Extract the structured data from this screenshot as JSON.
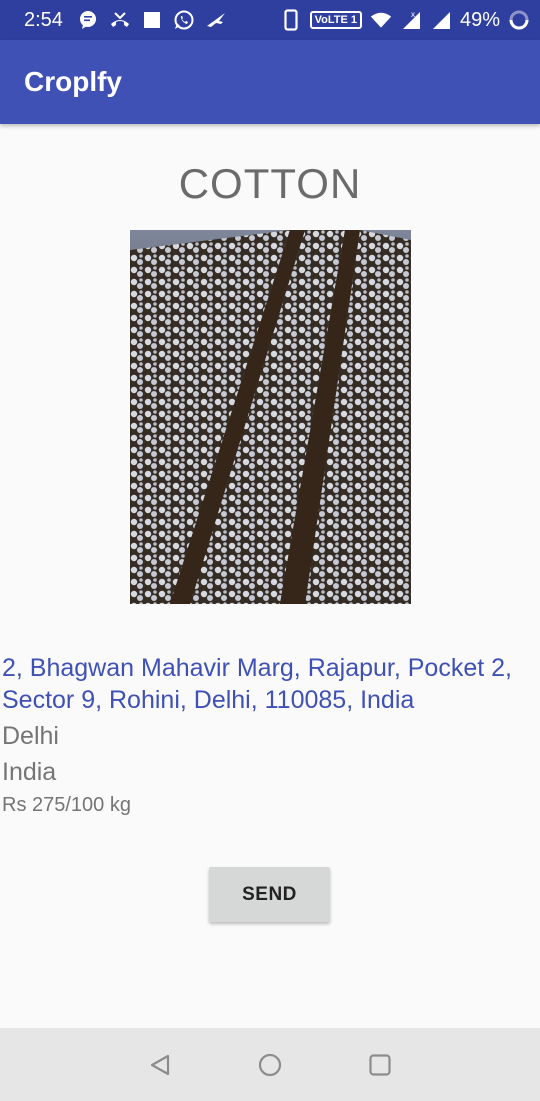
{
  "status_bar": {
    "time": "2:54",
    "network_label": "VoLTE 1",
    "battery_percent": "49%",
    "icons_left": [
      "message-icon",
      "missed-call-icon",
      "square-notification-icon",
      "whatsapp-icon",
      "flight-icon"
    ],
    "icons_right": [
      "phone-icon",
      "volte-icon",
      "wifi-icon",
      "signal-icon",
      "signal-icon",
      "battery-icon"
    ]
  },
  "app_bar": {
    "title": "Croplfy"
  },
  "crop": {
    "name": "COTTON",
    "image_icon": "cotton-field-photo"
  },
  "details": {
    "address": "2, Bhagwan Mahavir Marg, Rajapur, Pocket 2, Sector 9, Rohini, Delhi, 110085, India",
    "city": "Delhi",
    "country": "India",
    "price": "Rs 275/100 kg"
  },
  "actions": {
    "send_label": "SEND"
  },
  "nav_bar": {
    "buttons": [
      "back-icon",
      "home-icon",
      "recents-icon"
    ]
  },
  "colors": {
    "status_bar": "#2f3f9f",
    "app_bar": "#3f51b5",
    "address_text": "#3f51b5",
    "secondary_text": "#757575",
    "button_bg": "#d6d7d7",
    "nav_bar": "#e6e6e6"
  }
}
